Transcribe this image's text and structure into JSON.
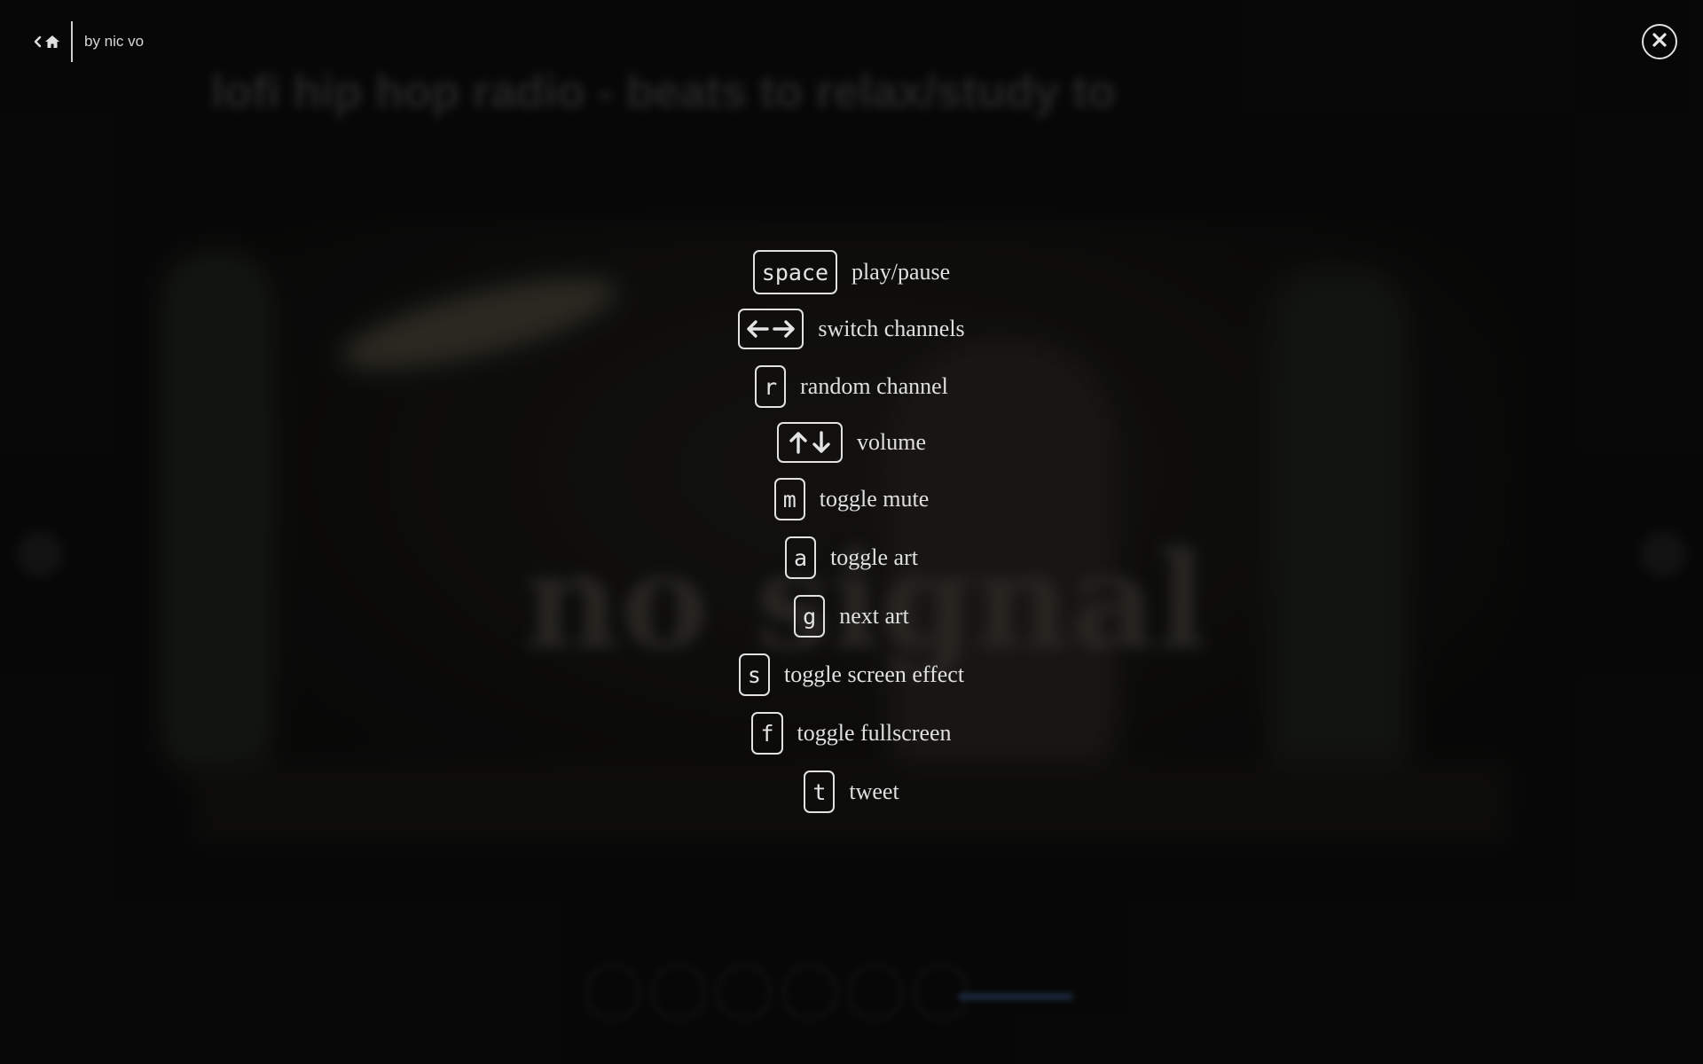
{
  "background": {
    "title": "lofi hip hop radio - beats to relax/study to",
    "status_text": "no signal"
  },
  "nav": {
    "home_icon": "home-icon",
    "back_icon": "chevron-left-icon",
    "author": "by nic vo"
  },
  "close": {
    "icon": "close-icon"
  },
  "shortcuts": [
    {
      "key": "space",
      "icon": null,
      "label": "play/pause"
    },
    {
      "key": "",
      "icon": "left-right-arrows-icon",
      "label": "switch channels"
    },
    {
      "key": "r",
      "icon": null,
      "label": "random channel"
    },
    {
      "key": "",
      "icon": "up-down-arrows-icon",
      "label": "volume"
    },
    {
      "key": "m",
      "icon": null,
      "label": "toggle mute"
    },
    {
      "key": "a",
      "icon": null,
      "label": "toggle art"
    },
    {
      "key": "g",
      "icon": null,
      "label": "next art"
    },
    {
      "key": "s",
      "icon": null,
      "label": "toggle screen effect"
    },
    {
      "key": "f",
      "icon": null,
      "label": "toggle fullscreen"
    },
    {
      "key": "t",
      "icon": null,
      "label": "tweet"
    }
  ],
  "colors": {
    "foreground": "#e2e2e2",
    "background": "#0c0c0c"
  }
}
